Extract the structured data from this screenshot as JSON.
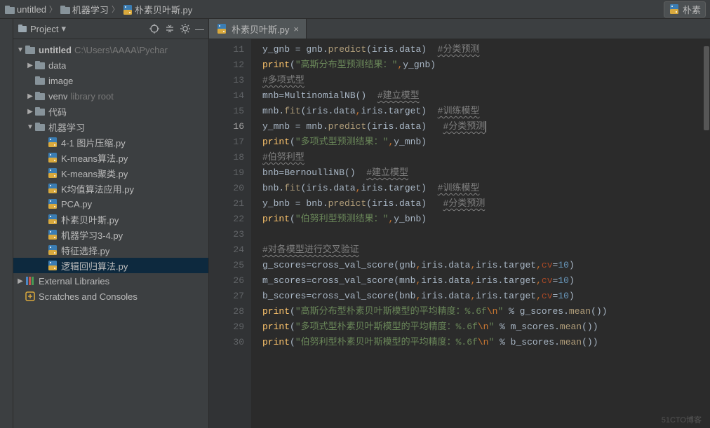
{
  "breadcrumbs": [
    {
      "icon": "folder",
      "label": "untitled"
    },
    {
      "icon": "folder",
      "label": "机器学习"
    },
    {
      "icon": "pyfile",
      "label": "朴素贝叶斯.py"
    }
  ],
  "right_button": {
    "icon": "pyfile",
    "label": "朴素"
  },
  "panel": {
    "title": "Project"
  },
  "tree": [
    {
      "depth": 0,
      "arrow": "down",
      "icon": "folder",
      "label": "untitled",
      "hint": "C:\\Users\\AAAA\\Pychar",
      "bold": true
    },
    {
      "depth": 1,
      "arrow": "right",
      "icon": "folder",
      "label": "data"
    },
    {
      "depth": 1,
      "arrow": "",
      "icon": "folder",
      "label": "image"
    },
    {
      "depth": 1,
      "arrow": "right",
      "icon": "folder",
      "label": "venv",
      "hint": "library root"
    },
    {
      "depth": 1,
      "arrow": "right",
      "icon": "folder",
      "label": "代码"
    },
    {
      "depth": 1,
      "arrow": "down",
      "icon": "folder",
      "label": "机器学习"
    },
    {
      "depth": 2,
      "arrow": "",
      "icon": "pyfile",
      "label": "4-1 图片压缩.py"
    },
    {
      "depth": 2,
      "arrow": "",
      "icon": "pyfile",
      "label": "K-means算法.py"
    },
    {
      "depth": 2,
      "arrow": "",
      "icon": "pyfile",
      "label": "K-means聚类.py"
    },
    {
      "depth": 2,
      "arrow": "",
      "icon": "pyfile",
      "label": "K均值算法应用.py"
    },
    {
      "depth": 2,
      "arrow": "",
      "icon": "pyfile",
      "label": "PCA.py"
    },
    {
      "depth": 2,
      "arrow": "",
      "icon": "pyfile",
      "label": "朴素贝叶斯.py"
    },
    {
      "depth": 2,
      "arrow": "",
      "icon": "pyfile",
      "label": "机器学习3-4.py"
    },
    {
      "depth": 2,
      "arrow": "",
      "icon": "pyfile",
      "label": "特征选择.py"
    },
    {
      "depth": 2,
      "arrow": "",
      "icon": "pyfile",
      "label": "逻辑回归算法.py",
      "sel": true
    },
    {
      "depth": 0,
      "arrow": "right",
      "icon": "lib",
      "label": "External Libraries"
    },
    {
      "depth": 0,
      "arrow": "",
      "icon": "scratch",
      "label": "Scratches and Consoles"
    }
  ],
  "tab": {
    "icon": "pyfile",
    "label": "朴素贝叶斯.py"
  },
  "currentLine": 16,
  "lineStart": 11,
  "code_lines": [
    {
      "n": 11,
      "tokens": [
        {
          "t": "y_gnb = gnb."
        },
        {
          "t": "predict",
          "c": "s-call"
        },
        {
          "t": "(iris.data)  "
        },
        {
          "t": "#分类预测",
          "c": "s-cmt underline-wave"
        }
      ]
    },
    {
      "n": 12,
      "tokens": [
        {
          "t": "print",
          "c": "s-fn"
        },
        {
          "t": "("
        },
        {
          "t": "\"高斯分布型预测结果：\"",
          "c": "s-str"
        },
        {
          "t": ",",
          "c": "s-kw"
        },
        {
          "t": "y_gnb)"
        }
      ]
    },
    {
      "n": 13,
      "tokens": [
        {
          "t": "#多项式型",
          "c": "s-cmt underline-wave"
        }
      ]
    },
    {
      "n": 14,
      "tokens": [
        {
          "t": "mnb=MultinomialNB()  "
        },
        {
          "t": "#建立模型",
          "c": "s-cmt underline-wave"
        }
      ]
    },
    {
      "n": 15,
      "tokens": [
        {
          "t": "mnb."
        },
        {
          "t": "fit",
          "c": "s-call"
        },
        {
          "t": "(iris.data"
        },
        {
          "t": ",",
          "c": "s-kw"
        },
        {
          "t": "iris.target)  "
        },
        {
          "t": "#训练模型",
          "c": "s-cmt underline-wave"
        }
      ]
    },
    {
      "n": 16,
      "tokens": [
        {
          "t": "y_mnb = mnb."
        },
        {
          "t": "predict",
          "c": "s-call"
        },
        {
          "t": "(iris.data)   "
        },
        {
          "t": "#分类预测",
          "c": "s-cmt underline-wave"
        }
      ],
      "caret": true
    },
    {
      "n": 17,
      "tokens": [
        {
          "t": "print",
          "c": "s-fn"
        },
        {
          "t": "("
        },
        {
          "t": "\"多项式型预测结果：\"",
          "c": "s-str"
        },
        {
          "t": ",",
          "c": "s-kw"
        },
        {
          "t": "y_mnb)"
        }
      ]
    },
    {
      "n": 18,
      "tokens": [
        {
          "t": "#伯努利型",
          "c": "s-cmt underline-wave"
        }
      ]
    },
    {
      "n": 19,
      "tokens": [
        {
          "t": "bnb=BernoulliNB()  "
        },
        {
          "t": "#建立模型",
          "c": "s-cmt underline-wave"
        }
      ]
    },
    {
      "n": 20,
      "tokens": [
        {
          "t": "bnb."
        },
        {
          "t": "fit",
          "c": "s-call"
        },
        {
          "t": "(iris.data"
        },
        {
          "t": ",",
          "c": "s-kw"
        },
        {
          "t": "iris.target)  "
        },
        {
          "t": "#训练模型",
          "c": "s-cmt underline-wave"
        }
      ]
    },
    {
      "n": 21,
      "tokens": [
        {
          "t": "y_bnb = bnb."
        },
        {
          "t": "predict",
          "c": "s-call"
        },
        {
          "t": "(iris.data)   "
        },
        {
          "t": "#分类预测",
          "c": "s-cmt underline-wave"
        }
      ]
    },
    {
      "n": 22,
      "tokens": [
        {
          "t": "print",
          "c": "s-fn"
        },
        {
          "t": "("
        },
        {
          "t": "\"伯努利型预测结果：\"",
          "c": "s-str"
        },
        {
          "t": ",",
          "c": "s-kw"
        },
        {
          "t": "y_bnb)"
        }
      ]
    },
    {
      "n": 23,
      "tokens": [
        {
          "t": ""
        }
      ]
    },
    {
      "n": 24,
      "tokens": [
        {
          "t": "#对各模型进行交叉验证",
          "c": "s-cmt underline-wave"
        }
      ]
    },
    {
      "n": 25,
      "tokens": [
        {
          "t": "g_scores=cross_val_score(gnb"
        },
        {
          "t": ",",
          "c": "s-kw"
        },
        {
          "t": "iris.data"
        },
        {
          "t": ",",
          "c": "s-kw"
        },
        {
          "t": "iris.target"
        },
        {
          "t": ",",
          "c": "s-kw"
        },
        {
          "t": "cv",
          "c": "s-param"
        },
        {
          "t": "="
        },
        {
          "t": "10",
          "c": "s-num"
        },
        {
          "t": ")"
        }
      ]
    },
    {
      "n": 26,
      "tokens": [
        {
          "t": "m_scores=cross_val_score(mnb"
        },
        {
          "t": ",",
          "c": "s-kw"
        },
        {
          "t": "iris.data"
        },
        {
          "t": ",",
          "c": "s-kw"
        },
        {
          "t": "iris.target"
        },
        {
          "t": ",",
          "c": "s-kw"
        },
        {
          "t": "cv",
          "c": "s-param"
        },
        {
          "t": "="
        },
        {
          "t": "10",
          "c": "s-num"
        },
        {
          "t": ")"
        }
      ]
    },
    {
      "n": 27,
      "tokens": [
        {
          "t": "b_scores=cross_val_score(bnb"
        },
        {
          "t": ",",
          "c": "s-kw"
        },
        {
          "t": "iris.data"
        },
        {
          "t": ",",
          "c": "s-kw"
        },
        {
          "t": "iris.target"
        },
        {
          "t": ",",
          "c": "s-kw"
        },
        {
          "t": "cv",
          "c": "s-param"
        },
        {
          "t": "="
        },
        {
          "t": "10",
          "c": "s-num"
        },
        {
          "t": ")"
        }
      ]
    },
    {
      "n": 28,
      "tokens": [
        {
          "t": "print",
          "c": "s-fn"
        },
        {
          "t": "("
        },
        {
          "t": "\"高斯分布型朴素贝叶斯模型的平均精度：%.6f",
          "c": "s-str"
        },
        {
          "t": "\\n",
          "c": "s-esc"
        },
        {
          "t": "\"",
          "c": "s-str"
        },
        {
          "t": " % g_scores."
        },
        {
          "t": "mean",
          "c": "s-call"
        },
        {
          "t": "())"
        }
      ]
    },
    {
      "n": 29,
      "tokens": [
        {
          "t": "print",
          "c": "s-fn"
        },
        {
          "t": "("
        },
        {
          "t": "\"多项式型朴素贝叶斯模型的平均精度：%.6f",
          "c": "s-str"
        },
        {
          "t": "\\n",
          "c": "s-esc"
        },
        {
          "t": "\"",
          "c": "s-str"
        },
        {
          "t": " % m_scores."
        },
        {
          "t": "mean",
          "c": "s-call"
        },
        {
          "t": "())"
        }
      ]
    },
    {
      "n": 30,
      "tokens": [
        {
          "t": "print",
          "c": "s-fn"
        },
        {
          "t": "("
        },
        {
          "t": "\"伯努利型朴素贝叶斯模型的平均精度：%.6f",
          "c": "s-str"
        },
        {
          "t": "\\n",
          "c": "s-esc"
        },
        {
          "t": "\"",
          "c": "s-str"
        },
        {
          "t": " % b_scores."
        },
        {
          "t": "mean",
          "c": "s-call"
        },
        {
          "t": "())"
        }
      ]
    }
  ],
  "watermark": "51CTO博客"
}
